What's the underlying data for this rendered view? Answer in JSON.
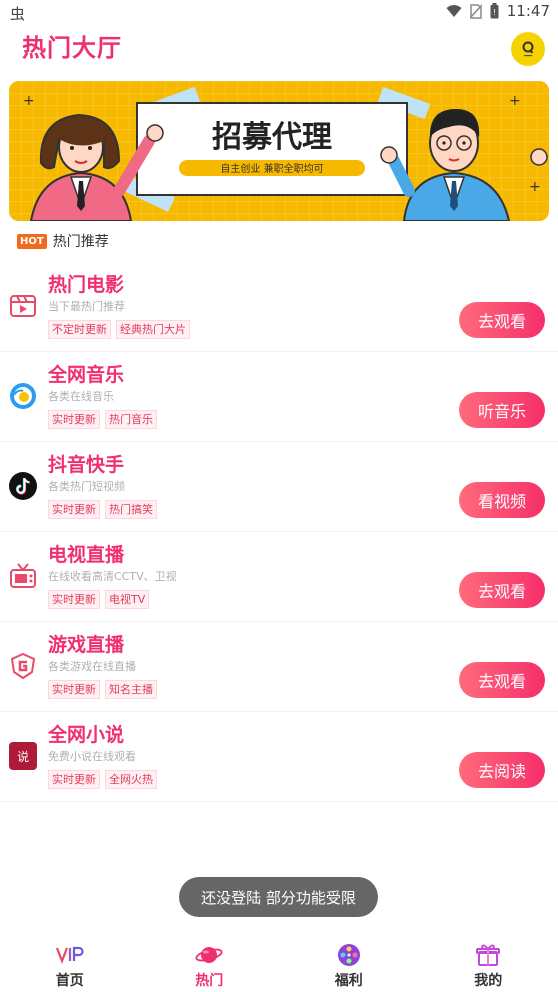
{
  "status_bar": {
    "carrier_glyph": "虫",
    "time": "11:47"
  },
  "header": {
    "title": "热门大厅"
  },
  "banner": {
    "headline": "招募代理",
    "subline": "自主创业 兼职全职均可"
  },
  "section": {
    "badge": "HOT",
    "title": "热门推荐"
  },
  "apps": [
    {
      "name": "热门电影",
      "desc": "当下最热门推荐",
      "tags": [
        "不定时更新",
        "经典热门大片"
      ],
      "action": "去观看",
      "icon": "film-icon"
    },
    {
      "name": "全网音乐",
      "desc": "各类在线音乐",
      "tags": [
        "实时更新",
        "热门音乐"
      ],
      "action": "听音乐",
      "icon": "music-icon"
    },
    {
      "name": "抖音快手",
      "desc": "各类热门短视频",
      "tags": [
        "实时更新",
        "热门搞笑"
      ],
      "action": "看视频",
      "icon": "tiktok-icon"
    },
    {
      "name": "电视直播",
      "desc": "在线收看高清CCTV、卫视",
      "tags": [
        "实时更新",
        "电视TV"
      ],
      "action": "去观看",
      "icon": "tv-icon"
    },
    {
      "name": "游戏直播",
      "desc": "各类游戏在线直播",
      "tags": [
        "实时更新",
        "知名主播"
      ],
      "action": "去观看",
      "icon": "game-shield-icon"
    },
    {
      "name": "全网小说",
      "desc": "免费小说在线观看",
      "tags": [
        "实时更新",
        "全网火热"
      ],
      "action": "去阅读",
      "icon": "novel-icon"
    }
  ],
  "toast": "还没登陆 部分功能受限",
  "nav": {
    "items": [
      {
        "label": "首页",
        "icon": "vip-icon",
        "active": false
      },
      {
        "label": "热门",
        "icon": "planet-icon",
        "active": true
      },
      {
        "label": "福利",
        "icon": "film-reel-icon",
        "active": false
      },
      {
        "label": "我的",
        "icon": "gift-icon",
        "active": false
      }
    ],
    "active_color": "#f0306e"
  },
  "colors": {
    "accent": "#f0306e",
    "banner_bg": "#f7b800",
    "hot_badge": "#f26a1b"
  }
}
